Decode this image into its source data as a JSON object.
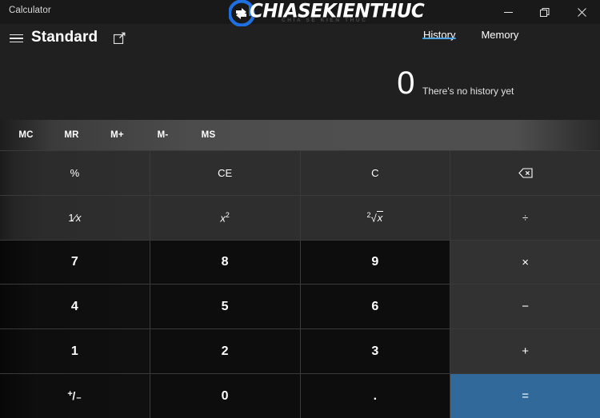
{
  "window": {
    "app_title": "Calculator",
    "controls": [
      {
        "name": "minimize",
        "label": "─"
      },
      {
        "name": "maximize",
        "label": "❐"
      },
      {
        "name": "close",
        "label": "✕"
      }
    ]
  },
  "header": {
    "menu_icon": "hamburger-menu-icon",
    "mode": "Standard",
    "keep_on_top_icon": "keep-on-top-icon",
    "tabs": [
      {
        "label": "History",
        "active": true
      },
      {
        "label": "Memory",
        "active": false
      }
    ]
  },
  "display": {
    "value": "0",
    "history_empty_message": "There's no history yet"
  },
  "memory": {
    "buttons": [
      {
        "label": "MC",
        "name": "memory-clear"
      },
      {
        "label": "MR",
        "name": "memory-recall"
      },
      {
        "label": "M+",
        "name": "memory-add"
      },
      {
        "label": "M-",
        "name": "memory-subtract"
      },
      {
        "label": "MS",
        "name": "memory-store"
      }
    ]
  },
  "keypad": {
    "percent": "%",
    "clear_entry": "CE",
    "clear": "C",
    "backspace_icon": "backspace-icon",
    "reciprocal_num": "1",
    "reciprocal_den": "x",
    "square_base": "x",
    "square_exp": "2",
    "sqrt_index": "2",
    "sqrt_radicand": "x",
    "divide": "÷",
    "seven": "7",
    "eight": "8",
    "nine": "9",
    "multiply": "×",
    "four": "4",
    "five": "5",
    "six": "6",
    "minus": "−",
    "one": "1",
    "two": "2",
    "three": "3",
    "plus": "+",
    "plusminus_plus": "+",
    "plusminus_slash": "/",
    "plusminus_minus": "–",
    "zero": "0",
    "decimal": ".",
    "equals": "="
  },
  "watermark": {
    "text": "CHIASEKIENTHUC",
    "subtext": "CHIA SE KIEN THUC"
  },
  "colors": {
    "accent": "#4aa3e0",
    "equals": "#31699b",
    "operator": "#323232",
    "digit": "#0d0d0d",
    "function": "#2e2e2e",
    "window_bg": "#202020"
  }
}
